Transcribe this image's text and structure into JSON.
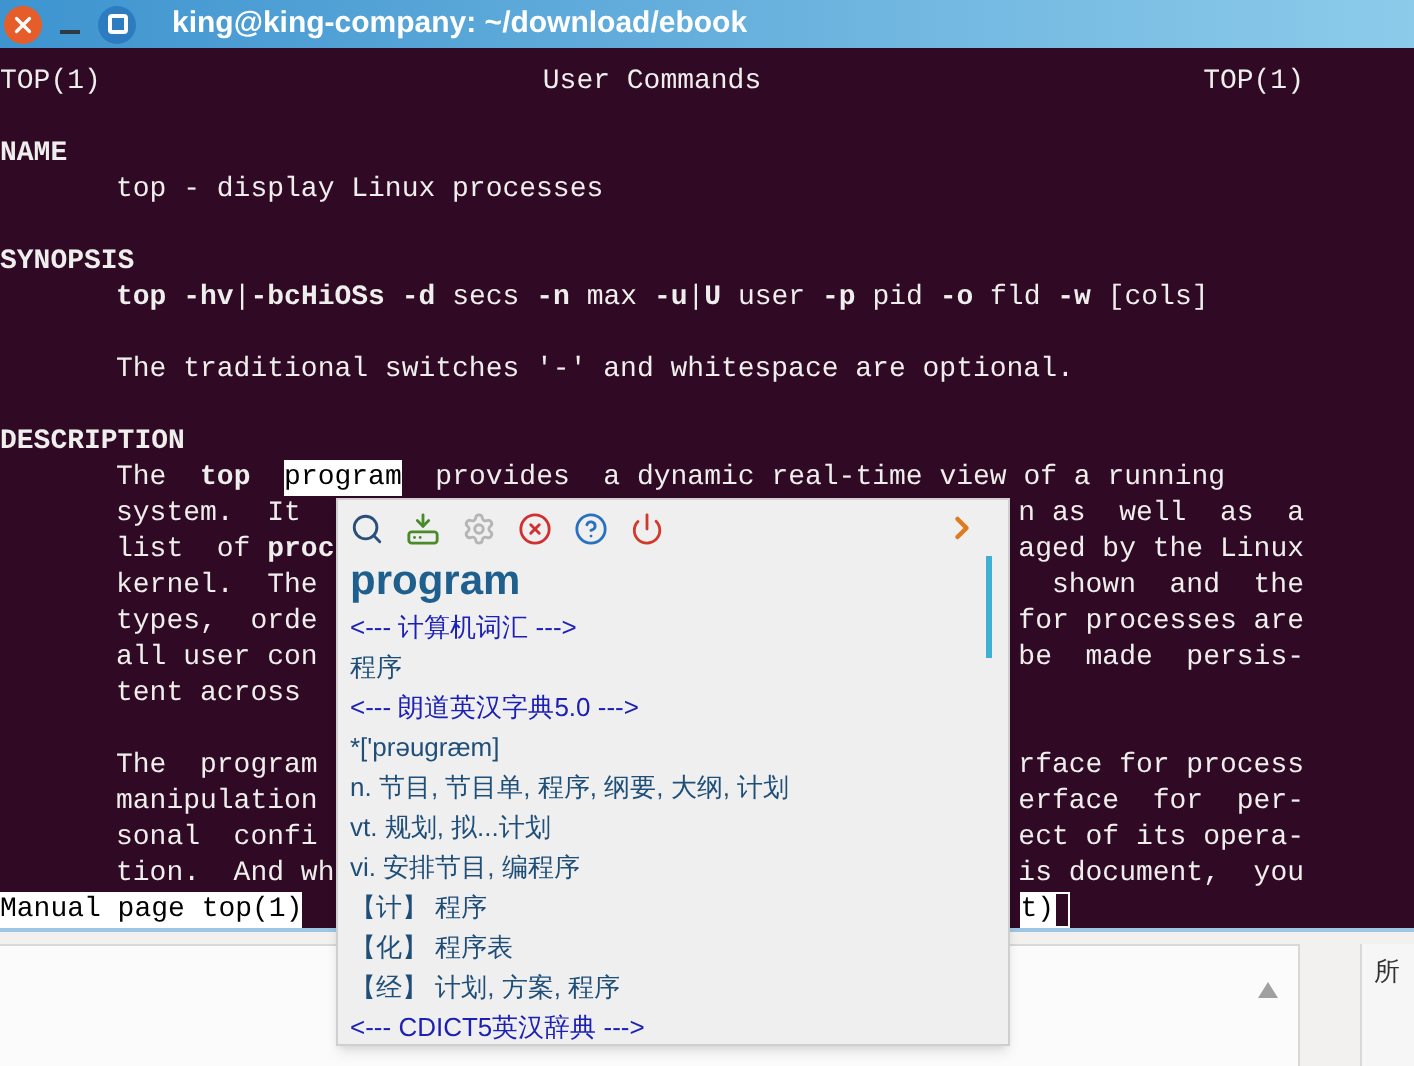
{
  "window": {
    "title": "king@king-company: ~/download/ebook"
  },
  "terminal": {
    "header": {
      "left": "TOP(1)",
      "center": "User Commands",
      "right": "TOP(1)"
    },
    "lines": [
      {
        "kind": "blank"
      },
      {
        "kind": "heading",
        "text": "NAME"
      },
      {
        "kind": "body",
        "text": "top - display Linux processes"
      },
      {
        "kind": "blank"
      },
      {
        "kind": "heading",
        "text": "SYNOPSIS"
      },
      {
        "kind": "body",
        "text": "**top** **-hv**|**-bcHiOSs** **-d** secs **-n** max **-u**|**U** user **-p** pid **-o** fld **-w** [cols]"
      },
      {
        "kind": "blank"
      },
      {
        "kind": "body",
        "text": "The traditional switches '-' and whitespace are optional."
      },
      {
        "kind": "blank"
      },
      {
        "kind": "heading",
        "text": "DESCRIPTION"
      },
      {
        "kind": "selection",
        "before": "The  **top**  ",
        "selected": "program",
        "after": "  provides  a dynamic real-time view of a running"
      },
      {
        "kind": "split",
        "left": "system.  It",
        "right": "n as  well  as  a"
      },
      {
        "kind": "split",
        "left": "list  of **proc**",
        "right": "aged by the Linux"
      },
      {
        "kind": "split",
        "left": "kernel.  The",
        "right": "shown  and  the"
      },
      {
        "kind": "split",
        "left": "types,  orde",
        "right": "for processes are"
      },
      {
        "kind": "split",
        "left": "all user con",
        "right": "be  made  persis-"
      },
      {
        "kind": "split",
        "left": "tent across"
      },
      {
        "kind": "blank"
      },
      {
        "kind": "split",
        "left": "The  program",
        "right": "rface for process"
      },
      {
        "kind": "split",
        "left": "manipulation",
        "right": "erface  for  per-"
      },
      {
        "kind": "split",
        "left": "sonal  confi",
        "right": "ect of its opera-"
      },
      {
        "kind": "split",
        "left": "tion.  And wh",
        "right": "is document,  you"
      }
    ],
    "status_line": {
      "left": "Manual page top(1)",
      "right": "t)"
    }
  },
  "popup": {
    "toolbar": [
      {
        "disabled": false
      },
      {
        "disabled": false
      },
      {
        "disabled": true
      },
      {
        "disabled": false
      },
      {
        "disabled": false
      },
      {
        "disabled": false
      }
    ],
    "word": "program",
    "entries": [
      {
        "kind": "source",
        "text": "<--- 计算机词汇 --->"
      },
      {
        "kind": "meaning",
        "text": "程序"
      },
      {
        "kind": "source",
        "text": "<--- 朗道英汉字典5.0 --->"
      },
      {
        "kind": "meaning",
        "text": "*['prəugræm]"
      },
      {
        "kind": "meaning",
        "text": "n. 节目, 节目单, 程序, 纲要, 大纲, 计划"
      },
      {
        "kind": "meaning",
        "text": "vt. 规划, 拟...计划"
      },
      {
        "kind": "meaning",
        "text": "vi. 安排节目, 编程序"
      },
      {
        "kind": "meaning",
        "text": "【计】 程序"
      },
      {
        "kind": "meaning",
        "text": "【化】 程序表"
      },
      {
        "kind": "meaning",
        "text": "【经】 计划, 方案, 程序"
      },
      {
        "kind": "source",
        "text": "<--- CDICT5英汉辞典 --->"
      }
    ]
  },
  "side_panel": {
    "label": "所"
  }
}
